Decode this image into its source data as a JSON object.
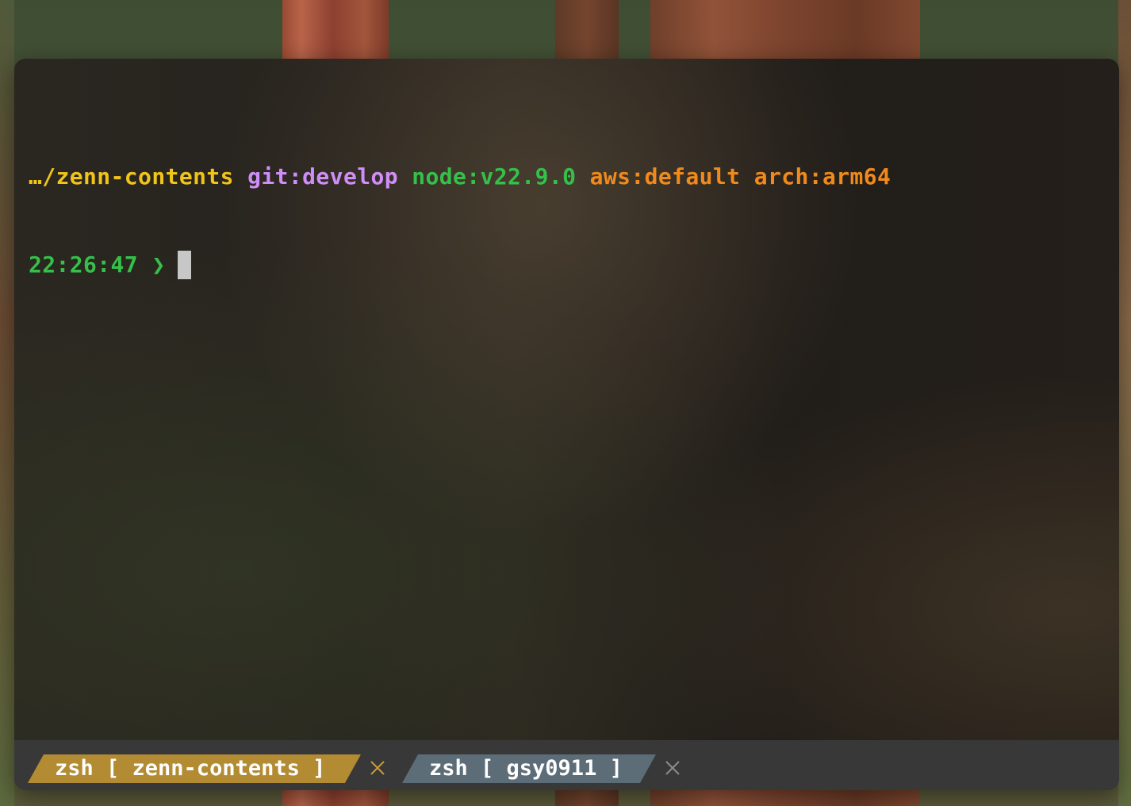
{
  "prompt": {
    "path": "…/zenn-contents",
    "git": "git:develop",
    "node": "node:v22.9.0",
    "aws": "aws:default",
    "arch": "arch:arm64",
    "time": "22:26:47",
    "symbol": "❯"
  },
  "tabs": [
    {
      "label": "zsh [ zenn-contents ]",
      "active": true,
      "color": "#b28b33"
    },
    {
      "label": "zsh [ gsy0911 ]",
      "active": false,
      "color": "#5d6d78"
    }
  ],
  "colors": {
    "path": "#f0c419",
    "git": "#cf8ef7",
    "node": "#35c04a",
    "aws": "#f08a1c",
    "arch": "#f08a1c",
    "time": "#35c04a",
    "symbol": "#35c04a",
    "close_active": "#c69a3a",
    "close_inactive": "#8c8c8c"
  },
  "icons": {
    "tab_close": "close-icon"
  }
}
